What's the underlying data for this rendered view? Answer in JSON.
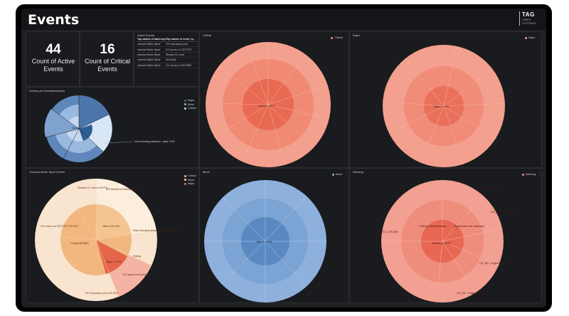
{
  "app": {
    "title": "Events",
    "logo": {
      "mark": "TAG",
      "sub": "VIDEO SYSTEMS"
    }
  },
  "stats": [
    {
      "value": "44",
      "label": "Count of Active Events"
    },
    {
      "value": "16",
      "label": "Count of Critical Events"
    }
  ],
  "active_events": {
    "title": "Active Events",
    "columns": [
      "Top values of label.keyw...",
      "Top values of event_ty..."
    ],
    "rows": [
      [
        "channel Motor Sport",
        "TOT Accuracy error"
      ],
      [
        "channel Motor Sport",
        "CC errors on TDT/TOT"
      ],
      [
        "channel Motor Sport",
        "Stream CC error"
      ],
      [
        "channel Motor Sport",
        "No Audio"
      ],
      [
        "channel Motor Sport",
        "CC errors on SDT/BAT"
      ]
    ]
  },
  "severity_colors": {
    "critical": "#f08a6c",
    "major": "#e9a0a0",
    "minor": "#8fb3dd",
    "warning": "#ef8f80"
  },
  "panels": {
    "channel": {
      "title": "Events per Channelname(s)",
      "legend": [
        "Major",
        "Minor",
        "Critical"
      ],
      "center_label": "Minor",
      "annotation": "Video blocking detection - peak: 0.5%"
    },
    "critical": {
      "title": "Critical",
      "legend": "Critical",
      "center_label": "Critical 100%"
    },
    "major": {
      "title": "Major",
      "legend": "Major",
      "center_label": "Major 100%"
    },
    "motor": {
      "title": "Channel Motor Sport Events",
      "legend": [
        "Critical",
        "Minor",
        "Major"
      ],
      "labels": [
        "Stream CC error 14.57%",
        "NIT Actual not found 14.8%",
        "CC errors on TDT/TOT 19.27%",
        "Minor 52.19%",
        "Video blocking detection - peak 10.57%",
        "Critical 52.88%",
        "Major 14.8%",
        "Timing",
        "EIT actual not found 14.8%",
        "TOT Accuracy error 20.32%"
      ]
    },
    "minor": {
      "title": "Minor",
      "legend": "Minor",
      "center_label": "Minor 100%"
    },
    "warning": {
      "title": "Warning",
      "legend": "Warning",
      "labels": [
        "SFTS_1 30.28%",
        "CH_406 - Edges 6.89%",
        "CH_398 - Edges 6.89%",
        "Delivery feed Restricted",
        "Stand frame rate mismatch",
        "Warning 100%",
        "CH_303 - Edges 6.89%",
        "CH_303 - Edges 6.89%"
      ]
    }
  }
}
